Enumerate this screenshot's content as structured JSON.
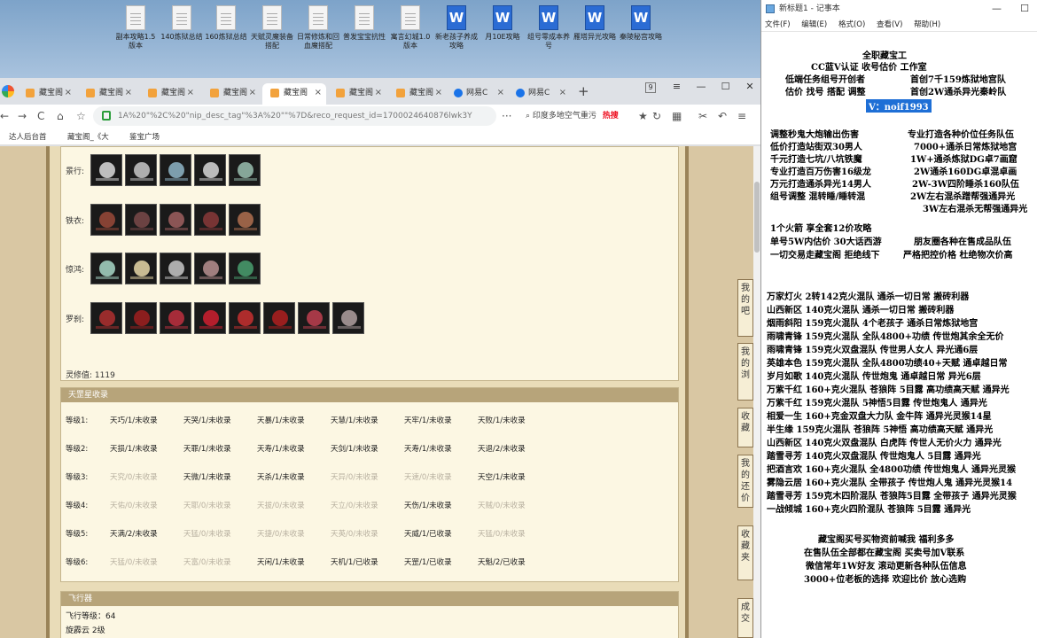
{
  "desktop": {
    "icons": [
      {
        "label": "副本攻略1.5版本",
        "type": "doc"
      },
      {
        "label": "140炼狱总结",
        "type": "doc"
      },
      {
        "label": "160炼狱总结",
        "type": "doc"
      },
      {
        "label": "天赋灵魔装备搭配",
        "type": "doc"
      },
      {
        "label": "日常修炼和回血魔搭配",
        "type": "doc"
      },
      {
        "label": "普发宝宝抗性",
        "type": "doc"
      },
      {
        "label": "寓言幻城1.0版本",
        "type": "doc"
      },
      {
        "label": "新老孩子养成攻略",
        "type": "word"
      },
      {
        "label": "月10E攻略",
        "type": "word"
      },
      {
        "label": "组号零成本养号",
        "type": "word"
      },
      {
        "label": "雁塔异光攻略",
        "type": "word"
      },
      {
        "label": "秦陵秘宫攻略",
        "type": "word"
      }
    ]
  },
  "browser": {
    "tabs": [
      {
        "label": "藏宝阁"
      },
      {
        "label": "藏宝阁"
      },
      {
        "label": "藏宝阁"
      },
      {
        "label": "藏宝阁"
      },
      {
        "label": "藏宝阁"
      },
      {
        "label": "藏宝阁"
      },
      {
        "label": "藏宝阁"
      },
      {
        "label": "网易C"
      },
      {
        "label": "网易C"
      }
    ],
    "tab_count_badge": "9",
    "window_controls": {
      "minimize": "—",
      "maximize": "☐",
      "close": "✕"
    },
    "url": "1A%20\"%2C%20\"nip_desc_tag\"%3A%20\"\"%7D&reco_request_id=1700024640876lwk3Y",
    "search_text": "印度多地空气重污",
    "search_tag": "热搜",
    "bookmarks": [
      "达人后台首",
      "藏宝阁_《大",
      "鉴宝广场"
    ]
  },
  "equipment": {
    "rows": [
      {
        "label": "景行:",
        "count": 5,
        "colors": [
          "#dcdcdc",
          "#c9c9c9",
          "#8fb6c8",
          "#d8d8d8",
          "#9ac0b0"
        ]
      },
      {
        "label": "铁衣:",
        "count": 5,
        "colors": [
          "#9a4a3a",
          "#7a4a4a",
          "#a06060",
          "#8a3a3a",
          "#b07050"
        ]
      },
      {
        "label": "惊鸿:",
        "count": 5,
        "colors": [
          "#a8d8c8",
          "#e8d8a8",
          "#c8c8c8",
          "#b89090",
          "#4aa070"
        ]
      },
      {
        "label": "罗刹:",
        "count": 8,
        "colors": [
          "#b03030",
          "#a02020",
          "#c03040",
          "#d02030",
          "#c83030",
          "#b02020",
          "#c04050",
          "#b0a0a0"
        ]
      }
    ],
    "lingxiu_label": "灵修值:",
    "lingxiu_value": "1119"
  },
  "tianzhen": {
    "header": "天罡星收录",
    "levels": [
      {
        "label": "等级1:",
        "cells": [
          {
            "text": "天巧/1/未收录",
            "dim": false
          },
          {
            "text": "天哭/1/未收录",
            "dim": false
          },
          {
            "text": "天暴/1/未收录",
            "dim": false
          },
          {
            "text": "天慧/1/未收录",
            "dim": false
          },
          {
            "text": "天牢/1/未收录",
            "dim": false
          },
          {
            "text": "天败/1/未收录",
            "dim": false
          }
        ]
      },
      {
        "label": "等级2:",
        "cells": [
          {
            "text": "天损/1/未收录",
            "dim": false
          },
          {
            "text": "天罪/1/未收录",
            "dim": false
          },
          {
            "text": "天寿/1/未收录",
            "dim": false
          },
          {
            "text": "天剑/1/未收录",
            "dim": false
          },
          {
            "text": "天寿/1/未收录",
            "dim": false
          },
          {
            "text": "天退/2/未收录",
            "dim": false
          }
        ]
      },
      {
        "label": "等级3:",
        "cells": [
          {
            "text": "天究/0/未收录",
            "dim": true
          },
          {
            "text": "天微/1/未收录",
            "dim": false
          },
          {
            "text": "天杀/1/未收录",
            "dim": false
          },
          {
            "text": "天异/0/未收录",
            "dim": true
          },
          {
            "text": "天速/0/未收录",
            "dim": true
          },
          {
            "text": "天空/1/未收录",
            "dim": false
          }
        ]
      },
      {
        "label": "等级4:",
        "cells": [
          {
            "text": "天佑/0/未收录",
            "dim": true
          },
          {
            "text": "天耶/0/未收录",
            "dim": true
          },
          {
            "text": "天拔/0/未收录",
            "dim": true
          },
          {
            "text": "天立/0/未收录",
            "dim": true
          },
          {
            "text": "天伤/1/未收录",
            "dim": false
          },
          {
            "text": "天贼/0/未收录",
            "dim": true
          }
        ]
      },
      {
        "label": "等级5:",
        "cells": [
          {
            "text": "天满/2/未收录",
            "dim": false
          },
          {
            "text": "天猛/0/未收录",
            "dim": true
          },
          {
            "text": "天捷/0/未收录",
            "dim": true
          },
          {
            "text": "天英/0/未收录",
            "dim": true
          },
          {
            "text": "天威/1/已收录",
            "dim": false
          },
          {
            "text": "天猛/0/未收录",
            "dim": true
          }
        ]
      },
      {
        "label": "等级6:",
        "cells": [
          {
            "text": "天猛/0/未收录",
            "dim": true
          },
          {
            "text": "天富/0/未收录",
            "dim": true
          },
          {
            "text": "天闲/1/未收录",
            "dim": false
          },
          {
            "text": "天机/1/已收录",
            "dim": false
          },
          {
            "text": "天罡/1/已收录",
            "dim": false
          },
          {
            "text": "天魁/2/已收录",
            "dim": false
          }
        ]
      }
    ]
  },
  "flight": {
    "header": "飞行器",
    "lines": [
      "飞行等级：64",
      "旋霹云  2级"
    ]
  },
  "right_boxes": [
    "我的吧",
    "我的浏",
    "收藏",
    "我的还价",
    "收藏夹",
    "成交"
  ],
  "notepad": {
    "title": "新标题1 - 记事本",
    "menu": [
      "文件(F)",
      "编辑(E)",
      "格式(O)",
      "查看(V)",
      "帮助(H)"
    ],
    "window_controls": {
      "minimize": "—",
      "maximize": "☐",
      "close": "✕"
    },
    "lines": [
      "全职藏宝工",
      "CC蓝V认证  收号估价  工作室",
      "低端任务组号开创者",
      "首创7千159炼狱地宫队",
      "估价 找号 搭配 调整",
      "首创2W通杀异光秦岭队",
      "V：noif1993",
      "调整秒鬼大炮输出伤害",
      "专业打造各种价位任务队伍",
      "低价打造站街双30男人",
      "7000+通杀日常炼狱地宫",
      "千元打造七坑/八坑铁魔",
      "1W+通杀炼狱DG卓7画窟",
      "专业打造百万伤害16级龙",
      "2W通杀160DG卓混卓画",
      "万元打造通杀异光14男人",
      "2W-3W四阶睡杀160队伍",
      "组号调整 混转睡/睡转混",
      "2W左右混杀蹭帮强通异光",
      "3W左右混杀无帮强通异光",
      "1个火箭 享全套12价攻略",
      "单号5W内估价 30大话西游",
      "朋友圈各种在售成品队伍",
      "一切交易走藏宝阁 拒绝线下",
      "严格把控价格 杜绝物次价高",
      "万家灯火 2转142克火混队 通杀一切日常 搬砖利器",
      "山西新区 140克火混队 通杀一切日常 搬砖利器",
      "烟雨斜阳 159克火混队 4个老孩子 通杀日常炼狱地宫",
      "雨啸青锋 159克火混队 全队4800+功绩 传世炮其余全无价",
      "雨啸青锋 159克火双盘混队 传世男人女人 异光通6层",
      "英雄本色 159克火混队 全队4800功绩40+天赋 通卓越日常",
      "岁月如歌 140克火混队 传世炮鬼 通卓越日常 异光6层",
      "万紫千红 160+克火混队 苍狼阵 5目露 高功绩高天赋 通异光",
      "万紫千红 159克火混队 5神悟5目露 传世炮鬼人 通异光",
      "相爱一生 160+克金双盘大力队 金牛阵 通异光灵猴14星",
      "半生缘   159克火混队 苍狼阵 5神悟 高功绩高天赋 通异光",
      "山西新区 140克火双盘混队 白虎阵 传世人无价火力 通异光",
      "踏雪寻芳 140克火双盘混队 传世炮鬼人 5目露 通异光",
      "把酒言欢 160+克火混队 全4800功绩 传世炮鬼人 通异光灵猴",
      "雾隐云居 160+克火混队 全带孩子 传世炮人鬼 通异光灵猴14",
      "踏雪寻芳 159克木四阶混队 苍狼阵5目露 全带孩子 通异光灵猴",
      "一战倾城 160+克火四阶混队 苍狼阵 5目露 通异光",
      "藏宝阁买号买物资前喊我 福利多多",
      "在售队伍全部都在藏宝阁 买卖号加V联系",
      "微信常年1W好友 滚动更新各种队伍信息",
      "3000+位老板的选择 欢迎比价 放心选购"
    ]
  }
}
